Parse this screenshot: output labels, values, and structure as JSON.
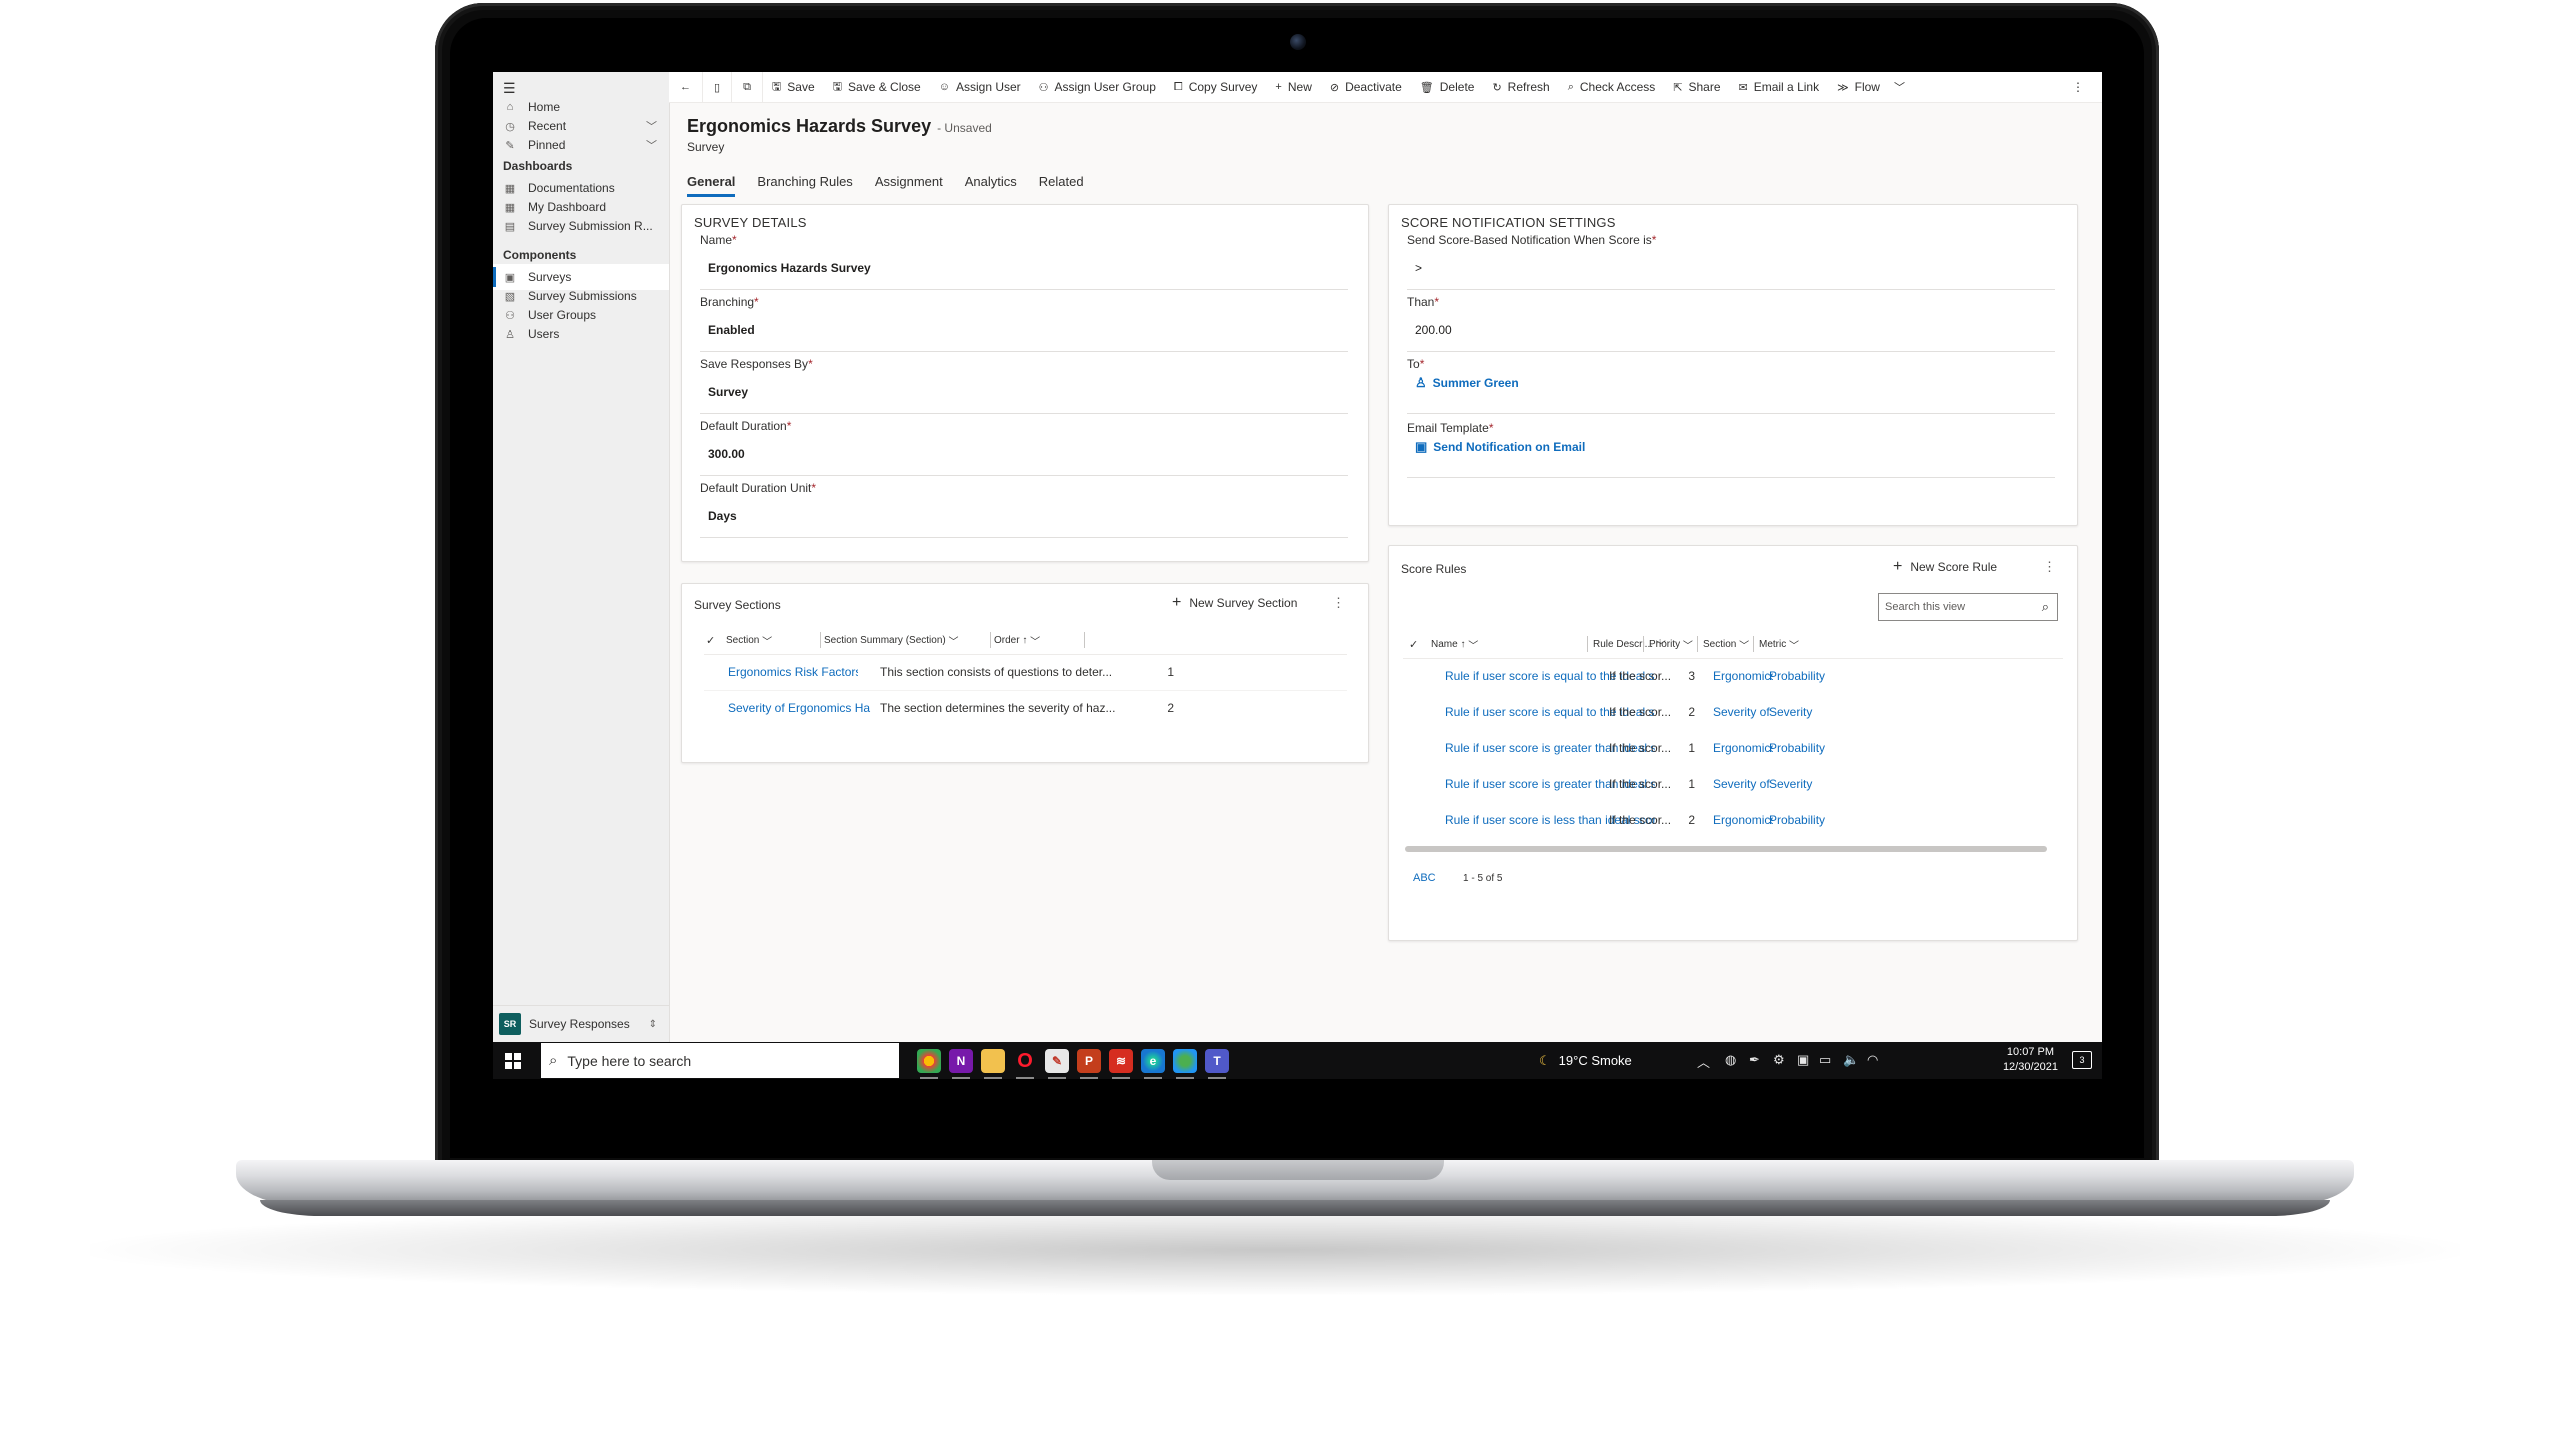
{
  "sidebar": {
    "items": [
      {
        "label": "Home",
        "icon": "home-icon"
      },
      {
        "label": "Recent",
        "icon": "clock-icon"
      },
      {
        "label": "Pinned",
        "icon": "pin-icon"
      }
    ],
    "dashboards_heading": "Dashboards",
    "dashboards": [
      {
        "label": "Documentations"
      },
      {
        "label": "My Dashboard"
      },
      {
        "label": "Survey Submission R..."
      }
    ],
    "components_heading": "Components",
    "components": [
      {
        "label": "Surveys",
        "active": true
      },
      {
        "label": "Survey Submissions"
      },
      {
        "label": "User Groups"
      },
      {
        "label": "Users"
      }
    ],
    "area": {
      "badge": "SR",
      "label": "Survey Responses"
    }
  },
  "commands": {
    "save": "Save",
    "save_close": "Save & Close",
    "assign_user": "Assign User",
    "assign_user_group": "Assign User Group",
    "copy_survey": "Copy Survey",
    "new": "New",
    "deactivate": "Deactivate",
    "delete": "Delete",
    "refresh": "Refresh",
    "check_access": "Check Access",
    "share": "Share",
    "email_link": "Email a Link",
    "flow": "Flow"
  },
  "form": {
    "title": "Ergonomics Hazards Survey",
    "state": "- Unsaved",
    "entity": "Survey",
    "tabs": [
      "General",
      "Branching Rules",
      "Assignment",
      "Analytics",
      "Related"
    ]
  },
  "survey_details": {
    "title": "SURVEY DETAILS",
    "fields": [
      {
        "label": "Name",
        "value": "Ergonomics Hazards Survey"
      },
      {
        "label": "Branching",
        "value": "Enabled"
      },
      {
        "label": "Save Responses By",
        "value": "Survey"
      },
      {
        "label": "Default Duration",
        "value": "300.00"
      },
      {
        "label": "Default Duration Unit",
        "value": "Days"
      }
    ]
  },
  "score_notification": {
    "title": "SCORE NOTIFICATION SETTINGS",
    "fields": [
      {
        "label": "Send Score-Based Notification When Score is",
        "value": ">"
      },
      {
        "label": "Than",
        "value": "200.00"
      },
      {
        "label": "To",
        "value": "Summer Green"
      },
      {
        "label": "Email Template",
        "value": "Send Notification on Email"
      }
    ]
  },
  "survey_sections": {
    "title": "Survey Sections",
    "new_label": "New Survey Section",
    "columns": [
      "Section",
      "Section Summary (Section)",
      "Order"
    ],
    "rows": [
      {
        "section": "Ergonomics Risk Factors",
        "summary": "This section consists of questions to deter...",
        "order": "1"
      },
      {
        "section": "Severity of Ergonomics Ha",
        "summary": "The section determines the severity of haz...",
        "order": "2"
      }
    ]
  },
  "score_rules": {
    "title": "Score Rules",
    "new_label": "New Score Rule",
    "search_placeholder": "Search this view",
    "columns": [
      "Name",
      "Rule Descri...",
      "Priority",
      "Section",
      "Metric"
    ],
    "rows": [
      {
        "name": "Rule if user score is equal to the ideal score",
        "desc": "If the scor...",
        "priority": "3",
        "section": "Ergonomics Ris",
        "metric": "Probability"
      },
      {
        "name": "Rule if user score is equal to the ideal score",
        "desc": "If the scor...",
        "priority": "2",
        "section": "Severity of Erg",
        "metric": "Severity"
      },
      {
        "name": "Rule if user score is greater than ideal score",
        "desc": "If the scor...",
        "priority": "1",
        "section": "Ergonomics Ris",
        "metric": "Probability"
      },
      {
        "name": "Rule if user score is greater than ideal score",
        "desc": "If the scor...",
        "priority": "1",
        "section": "Severity of Erg",
        "metric": "Severity"
      },
      {
        "name": "Rule if user score is less than ideal score",
        "desc": "If the scor...",
        "priority": "2",
        "section": "Ergonomics Ris",
        "metric": "Probability"
      }
    ],
    "footer_abc": "ABC",
    "footer_count": "1 - 5 of 5"
  },
  "taskbar": {
    "search_placeholder": "Type here to search",
    "weather": "19°C  Smoke",
    "time": "10:07 PM",
    "date": "12/30/2021",
    "notifications": "3"
  }
}
